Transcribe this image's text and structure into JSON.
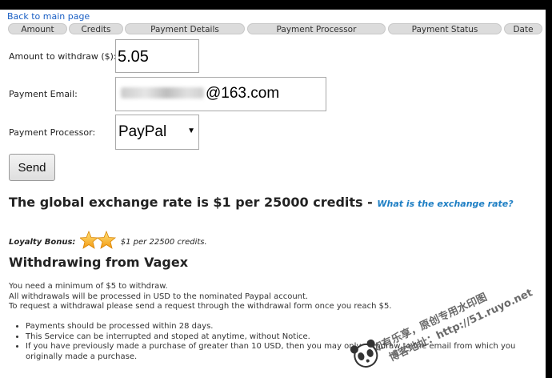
{
  "back_link": "Back to main page",
  "tabs": [
    "Amount",
    "Credits",
    "Payment Details",
    "Payment Processor",
    "Payment Status",
    "Date"
  ],
  "form": {
    "amount_label": "Amount to withdraw ($):",
    "amount_value": "5.05",
    "email_label": "Payment Email:",
    "email_value": "@163.com",
    "processor_label": "Payment Processor:",
    "processor_value": "PayPal",
    "send_label": "Send"
  },
  "rate": {
    "text": "The global exchange rate is $1 per 25000 credits - ",
    "link": "What is the exchange rate?"
  },
  "loyalty": {
    "label": "Loyalty Bonus:",
    "text": "$1 per 22500 credits.",
    "stars": 2
  },
  "withdraw": {
    "heading": "Withdrawing from Vagex",
    "lines": [
      "You need a minimum of $5 to withdraw.",
      "All withdrawals will be processed in USD to the nominated Paypal account.",
      "To request a withdrawal please send a request through the withdrawal form once you reach $5."
    ],
    "bullets": [
      "Payments should be processed within 28 days.",
      "This Service can be interrupted and stoped at anytime, without Notice.",
      "If you have previously made a purchase of greater than 10 USD, then you may only withdraw to the email from which you originally made a purchase."
    ]
  },
  "watermark": {
    "line1": "如有乐享，原创专用水印图",
    "line2": "博客地址：http://51.ruyo.net"
  }
}
